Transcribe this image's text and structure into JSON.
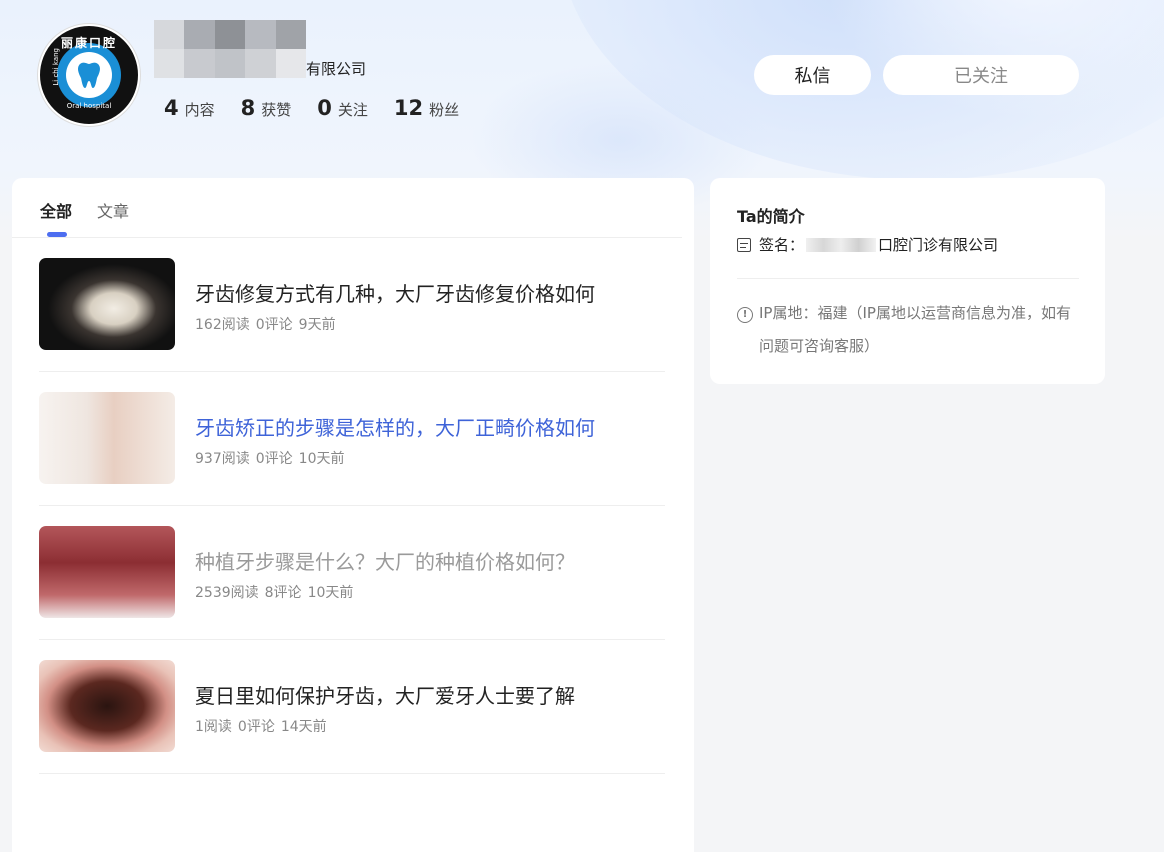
{
  "profile": {
    "name_suffix": "有限公司",
    "avatar_text_top": "丽康口腔",
    "avatar_text_side": "Li chi kang",
    "avatar_text_bottom": "Oral hospital",
    "stats": [
      {
        "num": "4",
        "label": "内容"
      },
      {
        "num": "8",
        "label": "获赞"
      },
      {
        "num": "0",
        "label": "关注"
      },
      {
        "num": "12",
        "label": "粉丝"
      }
    ]
  },
  "actions": {
    "message_label": "私信",
    "follow_label": "已关注"
  },
  "tabs": [
    {
      "label": "全部"
    },
    {
      "label": "文章"
    }
  ],
  "articles": [
    {
      "title": "牙齿修复方式有几种，大厂牙齿修复价格如何",
      "reads": "162阅读",
      "comments": "0评论",
      "time": "9天前"
    },
    {
      "title": "牙齿矫正的步骤是怎样的，大厂正畸价格如何",
      "reads": "937阅读",
      "comments": "0评论",
      "time": "10天前"
    },
    {
      "title": "种植牙步骤是什么？大厂的种植价格如何？",
      "reads": "2539阅读",
      "comments": "8评论",
      "time": "10天前"
    },
    {
      "title": "夏日里如何保护牙齿，大厂爱牙人士要了解",
      "reads": "1阅读",
      "comments": "0评论",
      "time": "14天前"
    }
  ],
  "intro": {
    "title": "Ta的简介",
    "sign_label": "签名：",
    "sign_value_prefix": "",
    "sign_value_suffix": "口腔门诊有限公司",
    "ip_text": "IP属地：福建（IP属地以运营商信息为准，如有问题可咨询客服）"
  },
  "colors": {
    "accent": "#4d6ef0",
    "link_hover": "#3e63d8"
  }
}
